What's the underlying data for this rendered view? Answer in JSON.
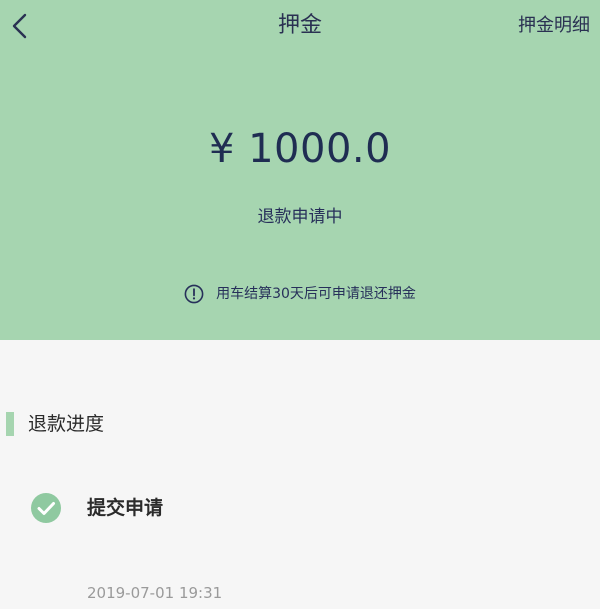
{
  "header": {
    "title": "押金",
    "detail_link": "押金明细",
    "back_icon": "chevron-left-icon",
    "background_color": "#a6d5b0"
  },
  "deposit": {
    "amount": "¥ 1000.0",
    "status": "退款申请中",
    "notice_icon": "info-circle-icon",
    "notice": "用车结算30天后可申请退还押金"
  },
  "progress": {
    "section_title": "退款进度",
    "steps": [
      {
        "icon": "check-circle-icon",
        "title": "提交申请",
        "time": "2019-07-01 19:31"
      }
    ]
  }
}
